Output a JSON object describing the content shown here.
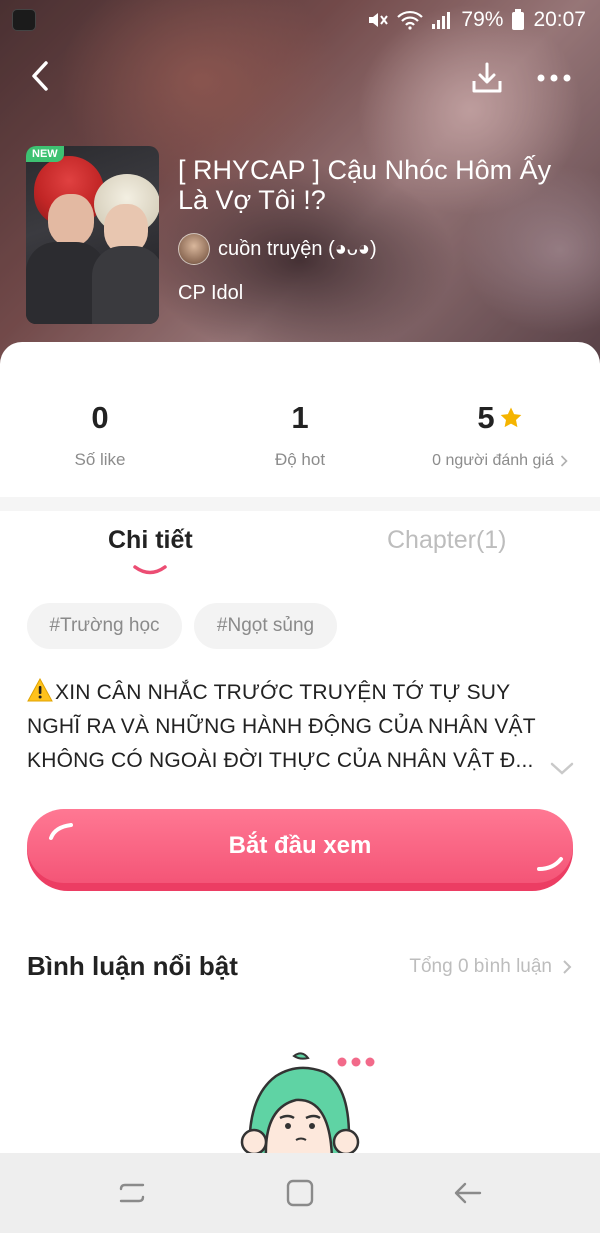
{
  "status_bar": {
    "battery": "79%",
    "time": "20:07",
    "icons": [
      "mute-icon",
      "wifi-icon",
      "signal-icon",
      "battery-icon"
    ]
  },
  "toolbar": {
    "icons": [
      "back-icon",
      "download-icon",
      "more-icon"
    ]
  },
  "cover": {
    "badge": "NEW"
  },
  "story": {
    "title": "[ RHYCAP ] Cậu Nhóc Hôm Ấy Là Vợ Tôi !?",
    "author": "cuồn truyện (◕ᴗ◕)",
    "genre": "CP Idol"
  },
  "stats": {
    "likes_value": "0",
    "likes_label": "Số like",
    "hot_value": "1",
    "hot_label": "Độ hot",
    "rating_value": "5",
    "rating_label": "0 người đánh giá",
    "star_color": "#f5b400"
  },
  "tabs": {
    "details": "Chi tiết",
    "chapter": "Chapter(1)",
    "active": "details"
  },
  "tags": [
    "#Trường học",
    "#Ngọt sủng"
  ],
  "description": "XIN CÂN NHẮC TRƯỚC TRUYỆN TỚ TỰ SUY NGHĨ RA VÀ NHỮNG HÀNH ĐỘNG CỦA NHÂN VẬT KHÔNG CÓ NGOÀI ĐỜI THỰC CỦA NHÂN VẬT Đ...",
  "cta": {
    "label": "Bắt đầu xem",
    "color": "#f45577"
  },
  "comments": {
    "title": "Bình luận nổi bật",
    "total": "Tổng 0 bình luận"
  },
  "nav": {
    "icons": [
      "recents-icon",
      "home-icon",
      "back-nav-icon"
    ]
  }
}
